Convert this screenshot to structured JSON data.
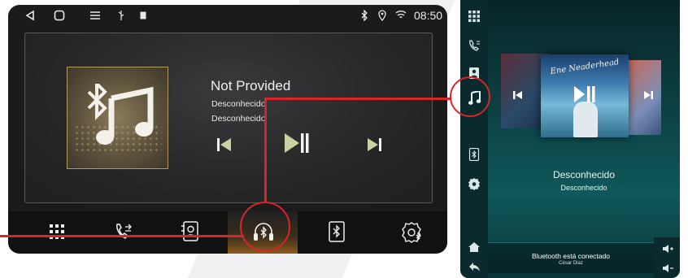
{
  "left_screen": {
    "status": {
      "time": "08:50",
      "icons": [
        "back-icon",
        "home-icon",
        "menu-icon",
        "usb-icon",
        "sd-card-icon",
        "bluetooth-icon",
        "location-icon",
        "wifi-icon"
      ]
    },
    "player": {
      "title": "Not Provided",
      "artist": "Desconhecido",
      "album": "Desconhecido",
      "album_art_icon": "bluetooth-music-icon",
      "controls": [
        "previous-icon",
        "play-pause-icon",
        "next-icon"
      ]
    },
    "nav": {
      "items": [
        "apps-grid-icon",
        "phone-transfer-icon",
        "contacts-icon",
        "bluetooth-music-icon",
        "bluetooth-phone-icon",
        "settings-bluetooth-icon"
      ],
      "active": "bluetooth-music-icon"
    }
  },
  "right_screen": {
    "sidebar": [
      "apps-grid-icon",
      "calls-icon",
      "contacts-icon",
      "music-note-icon",
      "bluetooth-phone-icon",
      "settings-icon"
    ],
    "active_sidebar": "music-note-icon",
    "track_title": "Desconhecido",
    "track_artist": "Desconhecido",
    "album_text": "Ene Neaderhead",
    "footer": {
      "status": "Bluetooth está conectado",
      "name": "César Diaz",
      "left_icons": [
        "home-icon",
        "back-icon"
      ],
      "right_icons": [
        "volume-up-icon",
        "volume-down-icon"
      ]
    }
  },
  "colors": {
    "accent_red": "#d7262b",
    "teal": "#0f585b",
    "orange_glow": "#8c5a1c"
  }
}
